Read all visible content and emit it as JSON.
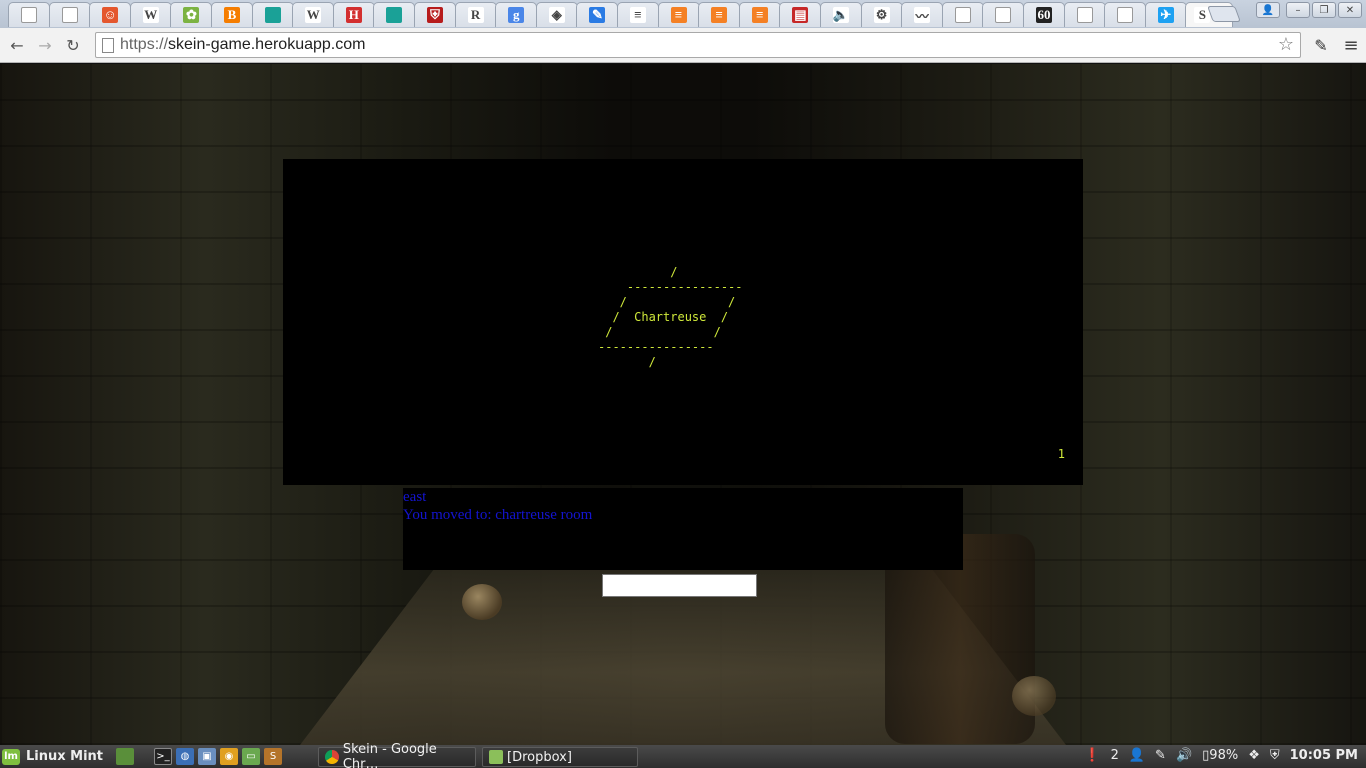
{
  "browser": {
    "tabs": [
      {
        "icon": "blank-page-icon",
        "color": "#ffffff",
        "glyph": ""
      },
      {
        "icon": "blank-page-icon",
        "color": "#ffffff",
        "glyph": ""
      },
      {
        "icon": "pixel-character-icon",
        "color": "#e4572e",
        "glyph": "☺"
      },
      {
        "icon": "wikipedia-icon",
        "color": "#ffffff",
        "glyph": "W"
      },
      {
        "icon": "leaf-icon",
        "color": "#7cb342",
        "glyph": "✿"
      },
      {
        "icon": "blogger-icon",
        "color": "#f57d00",
        "glyph": "B"
      },
      {
        "icon": "teal-square-icon",
        "color": "#1aa197",
        "glyph": ""
      },
      {
        "icon": "wikipedia-icon",
        "color": "#ffffff",
        "glyph": "W"
      },
      {
        "icon": "red-grid-icon",
        "color": "#d32f2f",
        "glyph": "H"
      },
      {
        "icon": "teal-square-icon",
        "color": "#1aa197",
        "glyph": ""
      },
      {
        "icon": "shield-icon",
        "color": "#b71c1c",
        "glyph": "⛨"
      },
      {
        "icon": "r-letter-icon",
        "color": "#ffffff",
        "glyph": "R"
      },
      {
        "icon": "google-icon",
        "color": "#4a86e8",
        "glyph": "g"
      },
      {
        "icon": "diamond-icon",
        "color": "#ffffff",
        "glyph": "◈"
      },
      {
        "icon": "jira-icon",
        "color": "#2a7be4",
        "glyph": "✎"
      },
      {
        "icon": "stackoverflow-icon",
        "color": "#ffffff",
        "glyph": "≡"
      },
      {
        "icon": "stackexchange-icon",
        "color": "#f48024",
        "glyph": "≡"
      },
      {
        "icon": "stackexchange-icon",
        "color": "#f48024",
        "glyph": "≡"
      },
      {
        "icon": "stackexchange-icon",
        "color": "#f48024",
        "glyph": "≡"
      },
      {
        "icon": "book-icon",
        "color": "#c62828",
        "glyph": "▤"
      },
      {
        "icon": "audio-playing-icon",
        "color": "#ffffff",
        "glyph": "🔈"
      },
      {
        "icon": "red-tool-icon",
        "color": "#ffffff",
        "glyph": "⚙"
      },
      {
        "icon": "chart-line-icon",
        "color": "#ffffff",
        "glyph": "〰"
      },
      {
        "icon": "blank-page-icon",
        "color": "#ffffff",
        "glyph": ""
      },
      {
        "icon": "blank-page-icon",
        "color": "#ffffff",
        "glyph": ""
      },
      {
        "icon": "speech-bubble-icon",
        "color": "#222222",
        "glyph": "60"
      },
      {
        "icon": "blank-page-icon",
        "color": "#ffffff",
        "glyph": ""
      },
      {
        "icon": "blank-page-icon",
        "color": "#ffffff",
        "glyph": ""
      },
      {
        "icon": "twitter-icon",
        "color": "#1da1f2",
        "glyph": "✈"
      },
      {
        "icon": "active-tab-icon",
        "color": "#ffffff",
        "glyph": "S"
      }
    ],
    "active_tab_close": "✕",
    "url_scheme": "https://",
    "url_host": "skein-game.herokuapp.com"
  },
  "game": {
    "map_ascii": "          /\n    ----------------\n   /              /\n  /  Chartreuse  /\n /              /\n----------------\n       /",
    "map_counter": "1",
    "log": [
      "east",
      "You moved to: chartreuse room"
    ],
    "command_value": ""
  },
  "taskbar": {
    "menu_label": "Linux Mint",
    "tasks": [
      {
        "label": "Skein - Google Chr…",
        "icon": "chrome-icon"
      },
      {
        "label": "[Dropbox]",
        "icon": "folder-icon"
      }
    ],
    "notification_count": "2",
    "battery": "98%",
    "clock": "10:05 PM"
  },
  "colors": {
    "map_text": "#cfe83a",
    "log_text": "#1414d0"
  }
}
